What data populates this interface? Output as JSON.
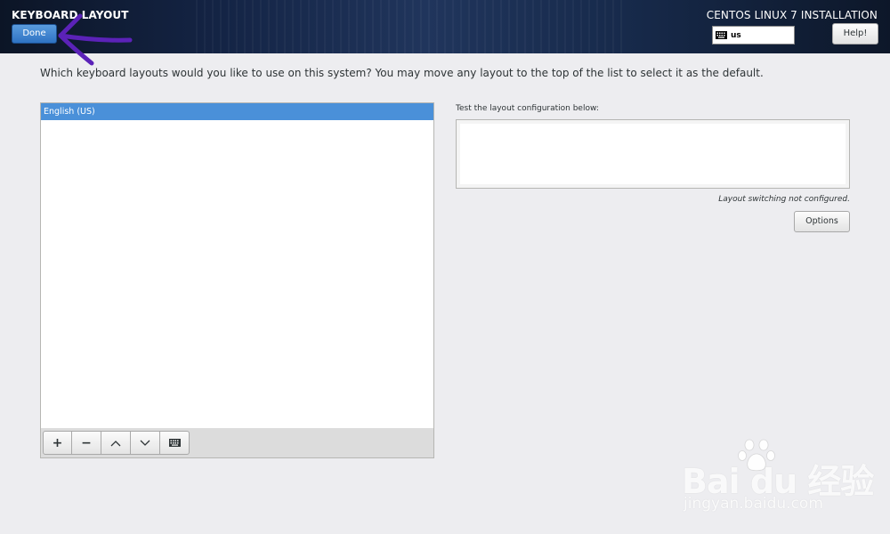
{
  "header": {
    "spoke_title": "KEYBOARD LAYOUT",
    "done_label": "Done",
    "product_title": "CENTOS LINUX 7 INSTALLATION",
    "layout_indicator": {
      "icon": "keyboard-icon",
      "code": "us"
    },
    "help_label": "Help!"
  },
  "annotation": {
    "color": "#5b22b8",
    "icon": "arrow-annotation"
  },
  "main": {
    "intro_text": "Which keyboard layouts would you like to use on this system?  You may move any layout to the top of the list to select it as the default.",
    "layouts": [
      {
        "label": "English (US)",
        "selected": true
      }
    ],
    "toolbar": [
      {
        "name": "add-layout-button",
        "glyph": "+",
        "icon": "plus-icon"
      },
      {
        "name": "remove-layout-button",
        "glyph": "−",
        "icon": "minus-icon"
      },
      {
        "name": "move-up-button",
        "glyph": "∧",
        "icon": "chevron-up-icon"
      },
      {
        "name": "move-down-button",
        "glyph": "∨",
        "icon": "chevron-down-icon"
      },
      {
        "name": "preview-layout-button",
        "glyph": "",
        "icon": "keyboard-icon"
      }
    ],
    "test_label": "Test the layout configuration below:",
    "test_value": "",
    "switching_note": "Layout switching not configured.",
    "options_label": "Options"
  },
  "watermark": {
    "brand": "Bai du 经验",
    "url": "jingyan.baidu.com"
  },
  "colors": {
    "accent": "#4a90d9",
    "header_dark": "#142445",
    "background": "#ededf0"
  }
}
